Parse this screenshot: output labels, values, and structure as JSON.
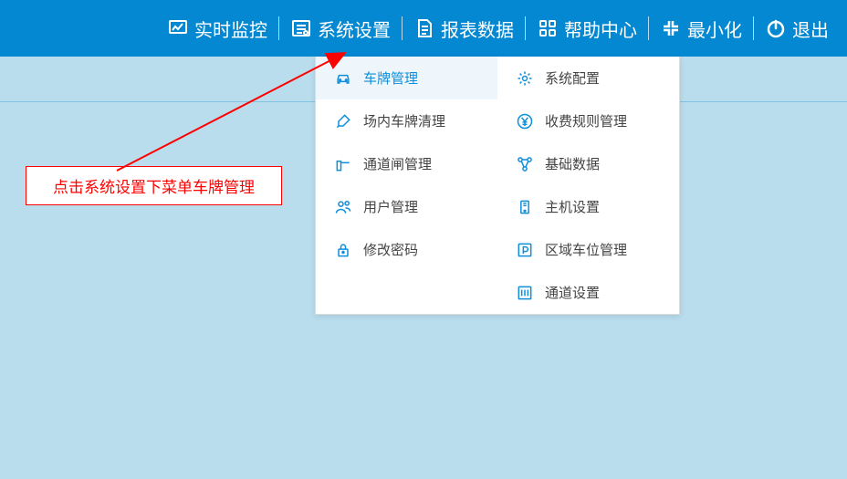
{
  "nav": {
    "monitor": "实时监控",
    "settings": "系统设置",
    "report": "报表数据",
    "help": "帮助中心",
    "minimize": "最小化",
    "exit": "退出"
  },
  "menu": {
    "col1": [
      {
        "label": "车牌管理",
        "active": true
      },
      {
        "label": "场内车牌清理",
        "active": false
      },
      {
        "label": "通道闸管理",
        "active": false
      },
      {
        "label": "用户管理",
        "active": false
      },
      {
        "label": "修改密码",
        "active": false
      }
    ],
    "col2": [
      {
        "label": "系统配置"
      },
      {
        "label": "收费规则管理"
      },
      {
        "label": "基础数据"
      },
      {
        "label": "主机设置"
      },
      {
        "label": "区域车位管理"
      },
      {
        "label": "通道设置"
      }
    ]
  },
  "callout": "点击系统设置下菜单车牌管理"
}
